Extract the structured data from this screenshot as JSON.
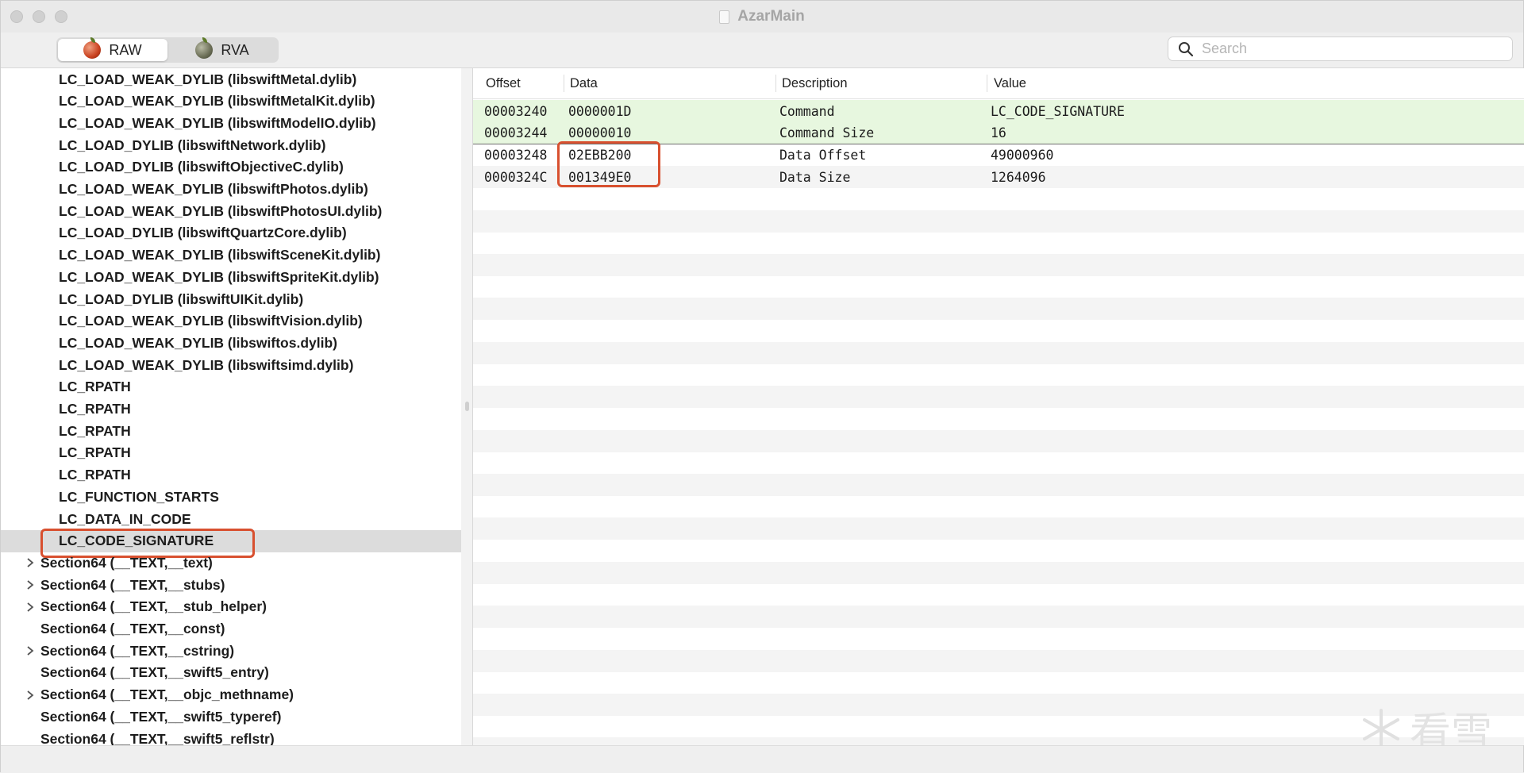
{
  "window": {
    "title": "AzarMain"
  },
  "toolbar": {
    "segments": [
      {
        "label": "RAW",
        "icon": "apple-red-icon",
        "selected": true
      },
      {
        "label": "RVA",
        "icon": "apple-grey-icon",
        "selected": false
      }
    ],
    "search_placeholder": "Search",
    "search_value": ""
  },
  "sidebar": {
    "items": [
      {
        "label": "LC_LOAD_WEAK_DYLIB (libswiftMetal.dylib)",
        "level": 2
      },
      {
        "label": "LC_LOAD_WEAK_DYLIB (libswiftMetalKit.dylib)",
        "level": 2
      },
      {
        "label": "LC_LOAD_WEAK_DYLIB (libswiftModelIO.dylib)",
        "level": 2
      },
      {
        "label": "LC_LOAD_DYLIB (libswiftNetwork.dylib)",
        "level": 2
      },
      {
        "label": "LC_LOAD_DYLIB (libswiftObjectiveC.dylib)",
        "level": 2
      },
      {
        "label": "LC_LOAD_WEAK_DYLIB (libswiftPhotos.dylib)",
        "level": 2
      },
      {
        "label": "LC_LOAD_WEAK_DYLIB (libswiftPhotosUI.dylib)",
        "level": 2
      },
      {
        "label": "LC_LOAD_DYLIB (libswiftQuartzCore.dylib)",
        "level": 2
      },
      {
        "label": "LC_LOAD_WEAK_DYLIB (libswiftSceneKit.dylib)",
        "level": 2
      },
      {
        "label": "LC_LOAD_WEAK_DYLIB (libswiftSpriteKit.dylib)",
        "level": 2
      },
      {
        "label": "LC_LOAD_DYLIB (libswiftUIKit.dylib)",
        "level": 2
      },
      {
        "label": "LC_LOAD_WEAK_DYLIB (libswiftVision.dylib)",
        "level": 2
      },
      {
        "label": "LC_LOAD_WEAK_DYLIB (libswiftos.dylib)",
        "level": 2
      },
      {
        "label": "LC_LOAD_WEAK_DYLIB (libswiftsimd.dylib)",
        "level": 2
      },
      {
        "label": "LC_RPATH",
        "level": 2
      },
      {
        "label": "LC_RPATH",
        "level": 2
      },
      {
        "label": "LC_RPATH",
        "level": 2
      },
      {
        "label": "LC_RPATH",
        "level": 2
      },
      {
        "label": "LC_RPATH",
        "level": 2
      },
      {
        "label": "LC_FUNCTION_STARTS",
        "level": 2
      },
      {
        "label": "LC_DATA_IN_CODE",
        "level": 2
      },
      {
        "label": "LC_CODE_SIGNATURE",
        "level": 2,
        "selected": true,
        "highlighted": true
      },
      {
        "label": "Section64 (__TEXT,__text)",
        "level": 1,
        "expandable": true
      },
      {
        "label": "Section64 (__TEXT,__stubs)",
        "level": 1,
        "expandable": true
      },
      {
        "label": "Section64 (__TEXT,__stub_helper)",
        "level": 1,
        "expandable": true
      },
      {
        "label": "Section64 (__TEXT,__const)",
        "level": 1,
        "expandable": false
      },
      {
        "label": "Section64 (__TEXT,__cstring)",
        "level": 1,
        "expandable": true
      },
      {
        "label": "Section64 (__TEXT,__swift5_entry)",
        "level": 1,
        "expandable": false
      },
      {
        "label": "Section64 (__TEXT,__objc_methname)",
        "level": 1,
        "expandable": true
      },
      {
        "label": "Section64 (__TEXT,__swift5_typeref)",
        "level": 1,
        "expandable": false
      },
      {
        "label": "Section64 (__TEXT,__swift5_reflstr)",
        "level": 1,
        "expandable": false
      }
    ]
  },
  "table": {
    "columns": [
      "Offset",
      "Data",
      "Description",
      "Value"
    ],
    "rows": [
      {
        "offset": "00003240",
        "data": "0000001D",
        "description": "Command",
        "value": "LC_CODE_SIGNATURE",
        "highlighted": true
      },
      {
        "offset": "00003244",
        "data": "00000010",
        "description": "Command Size",
        "value": "16",
        "highlighted": true
      },
      {
        "offset": "00003248",
        "data": "02EBB200",
        "description": "Data Offset",
        "value": "49000960",
        "highlighted": false
      },
      {
        "offset": "0000324C",
        "data": "001349E0",
        "description": "Data Size",
        "value": "1264096",
        "highlighted": false
      }
    ]
  },
  "colors": {
    "row_highlight": "#e7f7df",
    "annotation_box": "#d8502f",
    "selected_row": "#dcdcdc"
  },
  "watermark": {
    "text": "看雪"
  }
}
